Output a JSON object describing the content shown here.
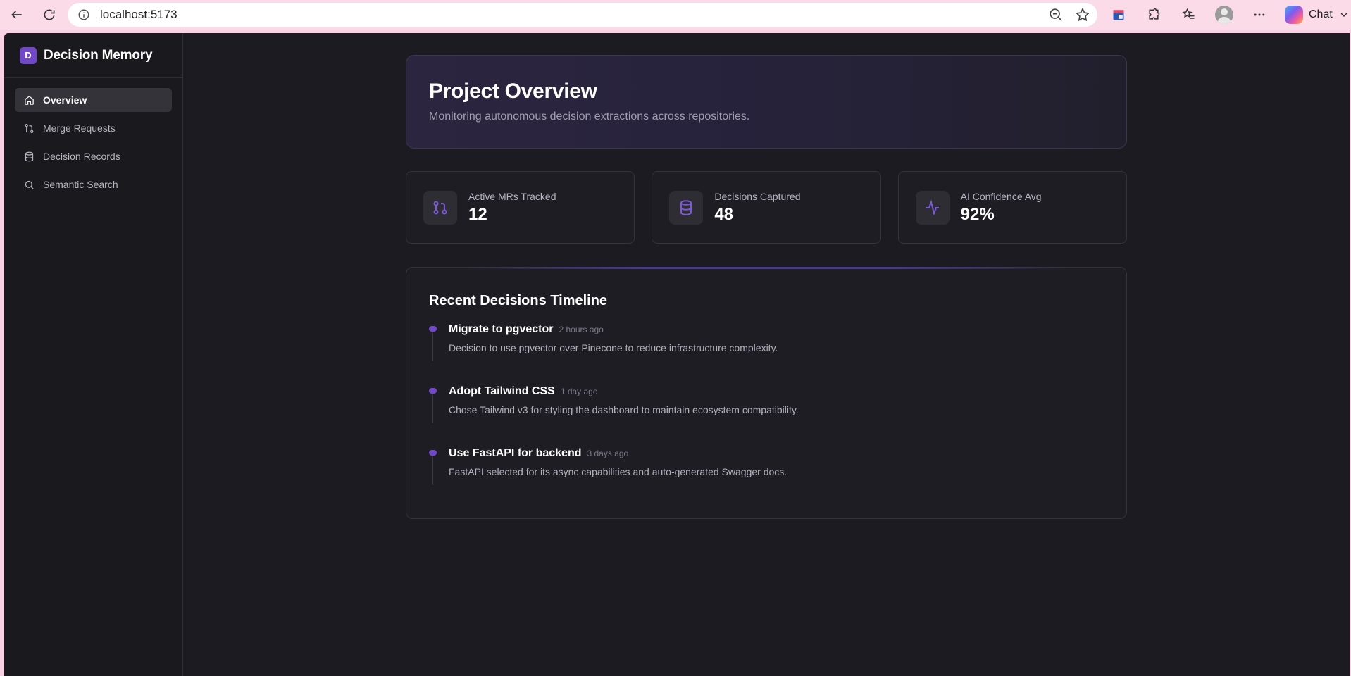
{
  "browser": {
    "url": "localhost:5173",
    "chat_label": "Chat"
  },
  "brand": {
    "badge": "D",
    "title": "Decision Memory"
  },
  "sidebar": {
    "items": [
      {
        "label": "Overview",
        "icon": "home-icon",
        "active": true
      },
      {
        "label": "Merge Requests",
        "icon": "git-merge-icon",
        "active": false
      },
      {
        "label": "Decision Records",
        "icon": "database-icon",
        "active": false
      },
      {
        "label": "Semantic Search",
        "icon": "search-icon",
        "active": false
      }
    ]
  },
  "hero": {
    "title": "Project Overview",
    "subtitle": "Monitoring autonomous decision extractions across repositories."
  },
  "stats": [
    {
      "label": "Active MRs Tracked",
      "value": "12",
      "icon": "git-pull-request-icon"
    },
    {
      "label": "Decisions Captured",
      "value": "48",
      "icon": "database-icon"
    },
    {
      "label": "AI Confidence Avg",
      "value": "92%",
      "icon": "activity-icon"
    }
  ],
  "timeline": {
    "title": "Recent Decisions Timeline",
    "items": [
      {
        "name": "Migrate to pgvector",
        "time": "2 hours ago",
        "desc": "Decision to use pgvector over Pinecone to reduce infrastructure complexity."
      },
      {
        "name": "Adopt Tailwind CSS",
        "time": "1 day ago",
        "desc": "Chose Tailwind v3 for styling the dashboard to maintain ecosystem compatibility."
      },
      {
        "name": "Use FastAPI for backend",
        "time": "3 days ago",
        "desc": "FastAPI selected for its async capabilities and auto-generated Swagger docs."
      }
    ]
  },
  "colors": {
    "accent": "#7048c8",
    "background": "#1c1b21",
    "sidebar": "#1a191e"
  }
}
